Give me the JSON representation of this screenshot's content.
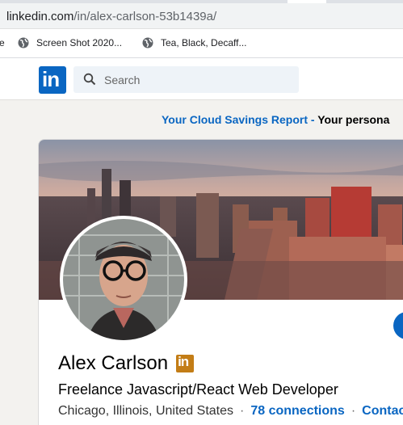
{
  "browser": {
    "url_host": "linkedin.com",
    "url_path": "/in/alex-carlson-53b1439a/",
    "bookmarks": [
      {
        "label": "e",
        "icon": "partial-icon"
      },
      {
        "label": "Screen Shot 2020...",
        "icon": "globe-icon"
      },
      {
        "label": "Tea, Black, Decaff...",
        "icon": "globe-icon"
      }
    ]
  },
  "linkedin": {
    "logo_text": "in",
    "search_placeholder": "Search",
    "accent_color": "#0a66c2"
  },
  "ad": {
    "link_text": "Your Cloud Savings Report",
    "separator": " - ",
    "rest_text": "Your persona"
  },
  "profile": {
    "name": "Alex Carlson",
    "badge_text": "in",
    "headline": "Freelance Javascript/React Web Developer",
    "location": "Chicago, Illinois, United States",
    "separator": "·",
    "connections": "78 connections",
    "contact": "Contac"
  }
}
